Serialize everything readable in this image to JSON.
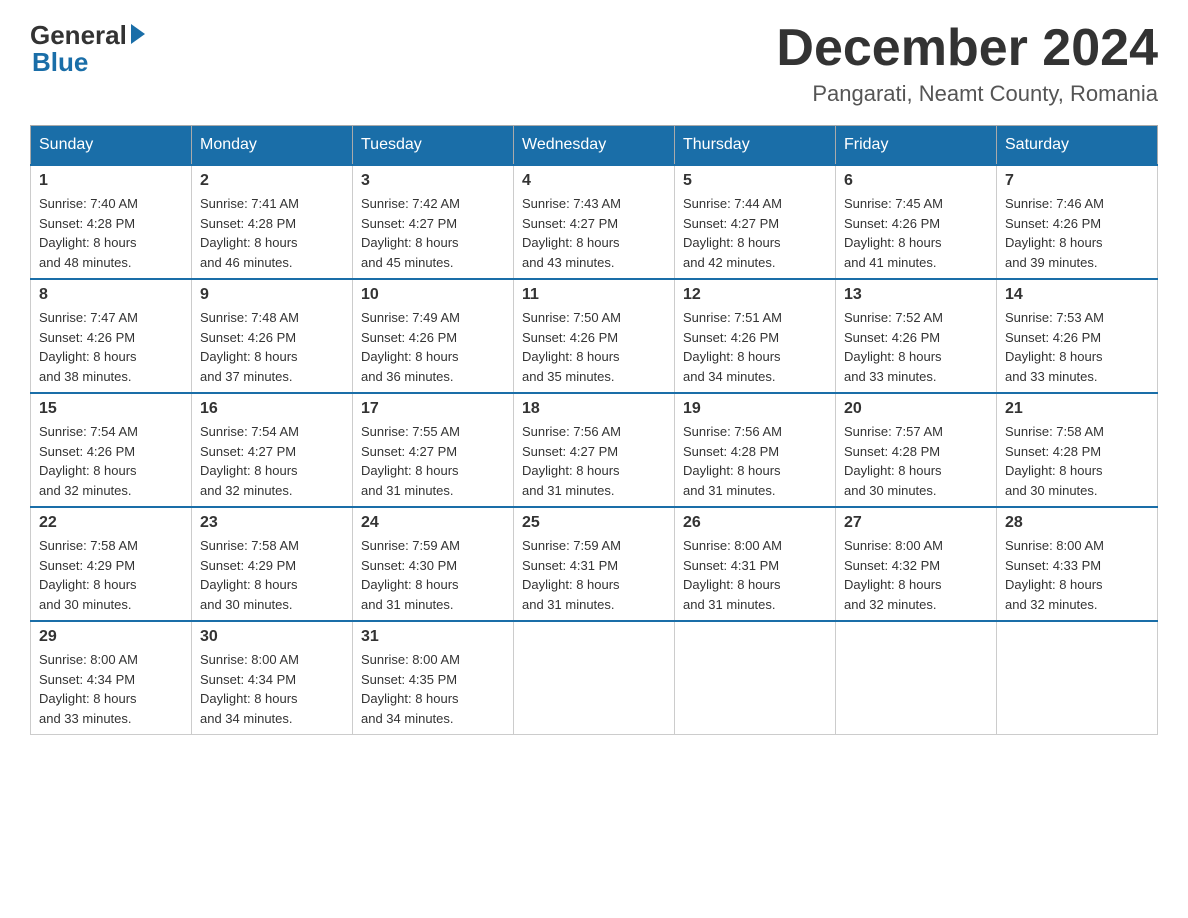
{
  "header": {
    "logo_general": "General",
    "logo_blue": "Blue",
    "month_title": "December 2024",
    "location": "Pangarati, Neamt County, Romania"
  },
  "calendar": {
    "weekdays": [
      "Sunday",
      "Monday",
      "Tuesday",
      "Wednesday",
      "Thursday",
      "Friday",
      "Saturday"
    ],
    "weeks": [
      [
        {
          "day": "1",
          "sunrise": "7:40 AM",
          "sunset": "4:28 PM",
          "daylight": "8 hours and 48 minutes."
        },
        {
          "day": "2",
          "sunrise": "7:41 AM",
          "sunset": "4:28 PM",
          "daylight": "8 hours and 46 minutes."
        },
        {
          "day": "3",
          "sunrise": "7:42 AM",
          "sunset": "4:27 PM",
          "daylight": "8 hours and 45 minutes."
        },
        {
          "day": "4",
          "sunrise": "7:43 AM",
          "sunset": "4:27 PM",
          "daylight": "8 hours and 43 minutes."
        },
        {
          "day": "5",
          "sunrise": "7:44 AM",
          "sunset": "4:27 PM",
          "daylight": "8 hours and 42 minutes."
        },
        {
          "day": "6",
          "sunrise": "7:45 AM",
          "sunset": "4:26 PM",
          "daylight": "8 hours and 41 minutes."
        },
        {
          "day": "7",
          "sunrise": "7:46 AM",
          "sunset": "4:26 PM",
          "daylight": "8 hours and 39 minutes."
        }
      ],
      [
        {
          "day": "8",
          "sunrise": "7:47 AM",
          "sunset": "4:26 PM",
          "daylight": "8 hours and 38 minutes."
        },
        {
          "day": "9",
          "sunrise": "7:48 AM",
          "sunset": "4:26 PM",
          "daylight": "8 hours and 37 minutes."
        },
        {
          "day": "10",
          "sunrise": "7:49 AM",
          "sunset": "4:26 PM",
          "daylight": "8 hours and 36 minutes."
        },
        {
          "day": "11",
          "sunrise": "7:50 AM",
          "sunset": "4:26 PM",
          "daylight": "8 hours and 35 minutes."
        },
        {
          "day": "12",
          "sunrise": "7:51 AM",
          "sunset": "4:26 PM",
          "daylight": "8 hours and 34 minutes."
        },
        {
          "day": "13",
          "sunrise": "7:52 AM",
          "sunset": "4:26 PM",
          "daylight": "8 hours and 33 minutes."
        },
        {
          "day": "14",
          "sunrise": "7:53 AM",
          "sunset": "4:26 PM",
          "daylight": "8 hours and 33 minutes."
        }
      ],
      [
        {
          "day": "15",
          "sunrise": "7:54 AM",
          "sunset": "4:26 PM",
          "daylight": "8 hours and 32 minutes."
        },
        {
          "day": "16",
          "sunrise": "7:54 AM",
          "sunset": "4:27 PM",
          "daylight": "8 hours and 32 minutes."
        },
        {
          "day": "17",
          "sunrise": "7:55 AM",
          "sunset": "4:27 PM",
          "daylight": "8 hours and 31 minutes."
        },
        {
          "day": "18",
          "sunrise": "7:56 AM",
          "sunset": "4:27 PM",
          "daylight": "8 hours and 31 minutes."
        },
        {
          "day": "19",
          "sunrise": "7:56 AM",
          "sunset": "4:28 PM",
          "daylight": "8 hours and 31 minutes."
        },
        {
          "day": "20",
          "sunrise": "7:57 AM",
          "sunset": "4:28 PM",
          "daylight": "8 hours and 30 minutes."
        },
        {
          "day": "21",
          "sunrise": "7:58 AM",
          "sunset": "4:28 PM",
          "daylight": "8 hours and 30 minutes."
        }
      ],
      [
        {
          "day": "22",
          "sunrise": "7:58 AM",
          "sunset": "4:29 PM",
          "daylight": "8 hours and 30 minutes."
        },
        {
          "day": "23",
          "sunrise": "7:58 AM",
          "sunset": "4:29 PM",
          "daylight": "8 hours and 30 minutes."
        },
        {
          "day": "24",
          "sunrise": "7:59 AM",
          "sunset": "4:30 PM",
          "daylight": "8 hours and 31 minutes."
        },
        {
          "day": "25",
          "sunrise": "7:59 AM",
          "sunset": "4:31 PM",
          "daylight": "8 hours and 31 minutes."
        },
        {
          "day": "26",
          "sunrise": "8:00 AM",
          "sunset": "4:31 PM",
          "daylight": "8 hours and 31 minutes."
        },
        {
          "day": "27",
          "sunrise": "8:00 AM",
          "sunset": "4:32 PM",
          "daylight": "8 hours and 32 minutes."
        },
        {
          "day": "28",
          "sunrise": "8:00 AM",
          "sunset": "4:33 PM",
          "daylight": "8 hours and 32 minutes."
        }
      ],
      [
        {
          "day": "29",
          "sunrise": "8:00 AM",
          "sunset": "4:34 PM",
          "daylight": "8 hours and 33 minutes."
        },
        {
          "day": "30",
          "sunrise": "8:00 AM",
          "sunset": "4:34 PM",
          "daylight": "8 hours and 34 minutes."
        },
        {
          "day": "31",
          "sunrise": "8:00 AM",
          "sunset": "4:35 PM",
          "daylight": "8 hours and 34 minutes."
        },
        null,
        null,
        null,
        null
      ]
    ],
    "labels": {
      "sunrise": "Sunrise: ",
      "sunset": "Sunset: ",
      "daylight": "Daylight: "
    }
  }
}
